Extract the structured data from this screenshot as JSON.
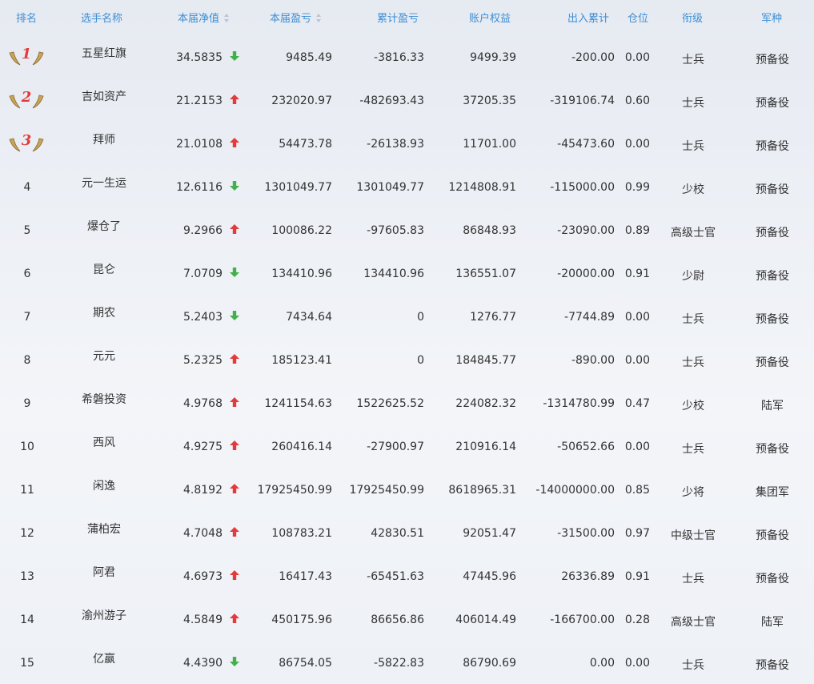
{
  "headers": {
    "rank": "排名",
    "name": "选手名称",
    "nav": "本届净值",
    "pnl": "本届盈亏",
    "cum_pnl": "累计盈亏",
    "equity": "账户权益",
    "flow": "出入累计",
    "position": "仓位",
    "title": "衔级",
    "branch": "军种"
  },
  "colors": {
    "header_text": "#3d8fd6",
    "up": "#e23b3b",
    "down": "#43b04a",
    "medal_gold": "#c9a35a",
    "medal_number": "#e23b3b"
  },
  "rows": [
    {
      "rank": "1",
      "medal": true,
      "name": "五星红旗",
      "nav": "34.5835",
      "trend": "down",
      "pnl": "9485.49",
      "cum_pnl": "-3816.33",
      "equity": "9499.39",
      "flow": "-200.00",
      "position": "0.00",
      "title": "士兵",
      "branch": "预备役"
    },
    {
      "rank": "2",
      "medal": true,
      "name": "吉如资产",
      "nav": "21.2153",
      "trend": "up",
      "pnl": "232020.97",
      "cum_pnl": "-482693.43",
      "equity": "37205.35",
      "flow": "-319106.74",
      "position": "0.60",
      "title": "士兵",
      "branch": "预备役"
    },
    {
      "rank": "3",
      "medal": true,
      "name": "拜师",
      "nav": "21.0108",
      "trend": "up",
      "pnl": "54473.78",
      "cum_pnl": "-26138.93",
      "equity": "11701.00",
      "flow": "-45473.60",
      "position": "0.00",
      "title": "士兵",
      "branch": "预备役"
    },
    {
      "rank": "4",
      "medal": false,
      "name": "元一生运",
      "nav": "12.6116",
      "trend": "down",
      "pnl": "1301049.77",
      "cum_pnl": "1301049.77",
      "equity": "1214808.91",
      "flow": "-115000.00",
      "position": "0.99",
      "title": "少校",
      "branch": "预备役"
    },
    {
      "rank": "5",
      "medal": false,
      "name": "爆仓了",
      "nav": "9.2966",
      "trend": "up",
      "pnl": "100086.22",
      "cum_pnl": "-97605.83",
      "equity": "86848.93",
      "flow": "-23090.00",
      "position": "0.89",
      "title": "高级士官",
      "branch": "预备役"
    },
    {
      "rank": "6",
      "medal": false,
      "name": "昆仑",
      "nav": "7.0709",
      "trend": "down",
      "pnl": "134410.96",
      "cum_pnl": "134410.96",
      "equity": "136551.07",
      "flow": "-20000.00",
      "position": "0.91",
      "title": "少尉",
      "branch": "预备役"
    },
    {
      "rank": "7",
      "medal": false,
      "name": "期农",
      "nav": "5.2403",
      "trend": "down",
      "pnl": "7434.64",
      "cum_pnl": "0",
      "equity": "1276.77",
      "flow": "-7744.89",
      "position": "0.00",
      "title": "士兵",
      "branch": "预备役"
    },
    {
      "rank": "8",
      "medal": false,
      "name": "元元",
      "nav": "5.2325",
      "trend": "up",
      "pnl": "185123.41",
      "cum_pnl": "0",
      "equity": "184845.77",
      "flow": "-890.00",
      "position": "0.00",
      "title": "士兵",
      "branch": "预备役"
    },
    {
      "rank": "9",
      "medal": false,
      "name": "希磐投资",
      "nav": "4.9768",
      "trend": "up",
      "pnl": "1241154.63",
      "cum_pnl": "1522625.52",
      "equity": "224082.32",
      "flow": "-1314780.99",
      "position": "0.47",
      "title": "少校",
      "branch": "陆军"
    },
    {
      "rank": "10",
      "medal": false,
      "name": "西风",
      "nav": "4.9275",
      "trend": "up",
      "pnl": "260416.14",
      "cum_pnl": "-27900.97",
      "equity": "210916.14",
      "flow": "-50652.66",
      "position": "0.00",
      "title": "士兵",
      "branch": "预备役"
    },
    {
      "rank": "11",
      "medal": false,
      "name": "闲逸",
      "nav": "4.8192",
      "trend": "up",
      "pnl": "17925450.99",
      "cum_pnl": "17925450.99",
      "equity": "8618965.31",
      "flow": "-14000000.00",
      "position": "0.85",
      "title": "少将",
      "branch": "集团军"
    },
    {
      "rank": "12",
      "medal": false,
      "name": "蒲柏宏",
      "nav": "4.7048",
      "trend": "up",
      "pnl": "108783.21",
      "cum_pnl": "42830.51",
      "equity": "92051.47",
      "flow": "-31500.00",
      "position": "0.97",
      "title": "中级士官",
      "branch": "预备役"
    },
    {
      "rank": "13",
      "medal": false,
      "name": "阿君",
      "nav": "4.6973",
      "trend": "up",
      "pnl": "16417.43",
      "cum_pnl": "-65451.63",
      "equity": "47445.96",
      "flow": "26336.89",
      "position": "0.91",
      "title": "士兵",
      "branch": "预备役"
    },
    {
      "rank": "14",
      "medal": false,
      "name": "渝州游子",
      "nav": "4.5849",
      "trend": "up",
      "pnl": "450175.96",
      "cum_pnl": "86656.86",
      "equity": "406014.49",
      "flow": "-166700.00",
      "position": "0.28",
      "title": "高级士官",
      "branch": "陆军"
    },
    {
      "rank": "15",
      "medal": false,
      "name": "亿赢",
      "nav": "4.4390",
      "trend": "down",
      "pnl": "86754.05",
      "cum_pnl": "-5822.83",
      "equity": "86790.69",
      "flow": "0.00",
      "position": "0.00",
      "title": "士兵",
      "branch": "预备役"
    }
  ]
}
